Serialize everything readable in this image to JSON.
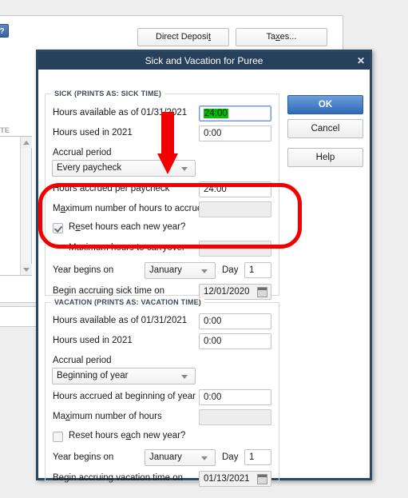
{
  "background": {
    "help_badge": "?",
    "buttons": [
      {
        "label_before": "Direct Deposi",
        "mnemonic": "t",
        "label_after": "",
        "full": "Direct Deposit"
      },
      {
        "label_before": "Ta",
        "mnemonic": "x",
        "label_after": "es...",
        "full": "Taxes..."
      }
    ],
    "column_header_partial": "ATE",
    "scroll_up_icon": "triangle-up-icon",
    "scroll_down_icon": "triangle-down-icon"
  },
  "dialog": {
    "title": "Sick and Vacation for Puree",
    "close_icon": "close-icon",
    "buttons": {
      "ok": "OK",
      "cancel": "Cancel",
      "help": "Help"
    },
    "sick": {
      "legend": "SICK (PRINTS AS: SICK TIME)",
      "hours_available_label": "Hours available as of 01/31/2021",
      "hours_available_value": "24:00",
      "hours_used_label": "Hours used in 2021",
      "hours_used_value": "0:00",
      "accrual_period_label": "Accrual period",
      "accrual_period_value": "Every paycheck",
      "hours_accrued_label": "Hours accrued per paycheck",
      "hours_accrued_value": "24:00",
      "max_hours_label_before": "M",
      "max_hours_label_mnemonic": "a",
      "max_hours_label_after": "ximum number of hours to accrue",
      "max_hours_value": "",
      "reset_label_before": "R",
      "reset_label_mnemonic": "e",
      "reset_label_after": "set hours each new year?",
      "reset_checked": true,
      "carryover_label": "Maximum hours to carryover",
      "carryover_value": "",
      "year_begins_label": "Year begins on",
      "year_begins_month": "January",
      "day_label": "Day",
      "day_value": "1",
      "begin_accruing_label": "Begin accruing sick time on",
      "begin_accruing_value": "12/01/2020",
      "calendar_icon": "calendar-icon"
    },
    "vacation": {
      "legend": "VACATION (PRINTS AS: VACATION TIME)",
      "hours_available_label": "Hours available as of 01/31/2021",
      "hours_available_value": "0:00",
      "hours_used_label": "Hours used in 2021",
      "hours_used_value": "0:00",
      "accrual_period_label": "Accrual period",
      "accrual_period_value": "Beginning of year",
      "hours_accrued_label": "Hours accrued at beginning of year",
      "hours_accrued_value": "0:00",
      "max_hours_label_before": "Ma",
      "max_hours_label_mnemonic": "x",
      "max_hours_label_after": "imum number of hours",
      "max_hours_value": "",
      "reset_label_before": "Reset hours e",
      "reset_label_mnemonic": "a",
      "reset_label_after": "ch new year?",
      "reset_checked": false,
      "year_begins_label": "Year begins on",
      "year_begins_month": "January",
      "day_label": "Day",
      "day_value": "1",
      "begin_accruing_label": "Begin accruing vacation time on",
      "begin_accruing_value": "01/13/2021",
      "calendar_icon": "calendar-icon"
    }
  },
  "annotations": {
    "highlight_rect_color": "#f20000",
    "arrow_color": "#f20000",
    "arrow_icon": "down-arrow-annotation"
  }
}
